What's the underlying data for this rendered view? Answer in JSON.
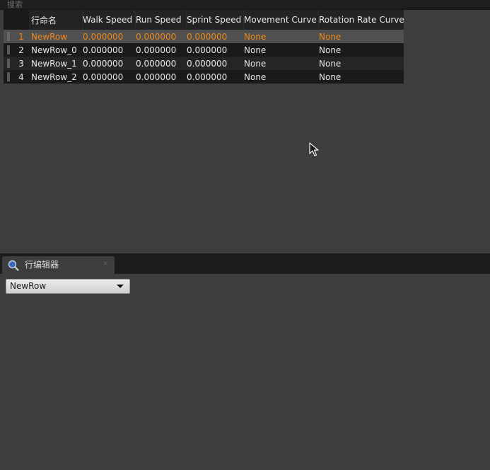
{
  "search": {
    "placeholder": "搜索"
  },
  "table": {
    "columns": [
      "行命名",
      "Walk Speed",
      "Run Speed",
      "Sprint Speed",
      "Movement Curve",
      "Rotation Rate Curve"
    ],
    "rows": [
      {
        "index": "1",
        "name": "NewRow",
        "walk": "0.000000",
        "run": "0.000000",
        "sprint": "0.000000",
        "movement": "None",
        "rotation": "None"
      },
      {
        "index": "2",
        "name": "NewRow_0",
        "walk": "0.000000",
        "run": "0.000000",
        "sprint": "0.000000",
        "movement": "None",
        "rotation": "None"
      },
      {
        "index": "3",
        "name": "NewRow_1",
        "walk": "0.000000",
        "run": "0.000000",
        "sprint": "0.000000",
        "movement": "None",
        "rotation": "None"
      },
      {
        "index": "4",
        "name": "NewRow_2",
        "walk": "0.000000",
        "run": "0.000000",
        "sprint": "0.000000",
        "movement": "None",
        "rotation": "None"
      }
    ],
    "selected_row": "1"
  },
  "row_editor": {
    "tab_label": "行编辑器",
    "tab_icon": "magnifier-icon",
    "selected_value": "NewRow"
  },
  "colors": {
    "selected_text": "#f08a1c",
    "panel_bg": "#3d3d3d"
  }
}
